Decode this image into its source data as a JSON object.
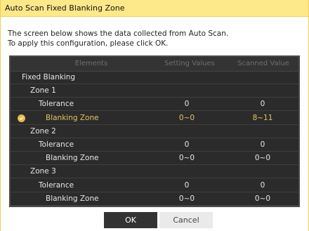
{
  "window": {
    "title": "Auto Scan Fixed Blanking Zone"
  },
  "description": {
    "line1": "The screen below shows the data collected from Auto Scan.",
    "line2": "To apply this configuration, please click OK."
  },
  "table": {
    "headers": {
      "elements": "Elements",
      "setting": "Setting Values",
      "scanned": "Scanned Value"
    },
    "rows": [
      {
        "name": "Fixed Blanking",
        "setting": "",
        "scanned": ""
      },
      {
        "name": "Zone 1",
        "setting": "",
        "scanned": ""
      },
      {
        "name": "Tolerance",
        "setting": "0",
        "scanned": "0"
      },
      {
        "name": "Blanking Zone",
        "setting": "0~0",
        "scanned": "8~11",
        "highlight": true
      },
      {
        "name": "Zone 2",
        "setting": "",
        "scanned": ""
      },
      {
        "name": "Tolerance",
        "setting": "0",
        "scanned": "0"
      },
      {
        "name": "Blanking Zone",
        "setting": "0~0",
        "scanned": "0~0"
      },
      {
        "name": "Zone 3",
        "setting": "",
        "scanned": ""
      },
      {
        "name": "Tolerance",
        "setting": "0",
        "scanned": "0"
      },
      {
        "name": "Blanking Zone",
        "setting": "0~0",
        "scanned": "0~0"
      }
    ]
  },
  "buttons": {
    "ok": "OK",
    "cancel": "Cancel"
  },
  "colors": {
    "titlebar": "#fde88a",
    "highlight": "#e6c35c",
    "table_bg": "#2b2b2b"
  },
  "icons": {
    "highlight_marker": "checkmark-circle-icon"
  }
}
